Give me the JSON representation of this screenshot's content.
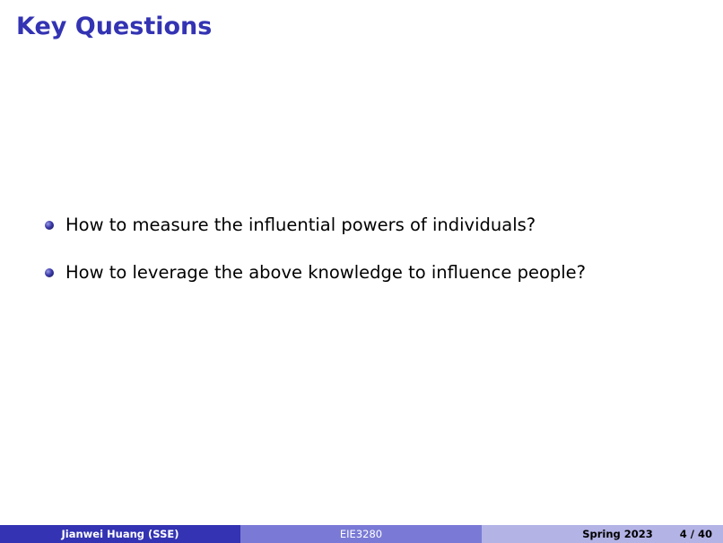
{
  "slide": {
    "title": "Key Questions",
    "bullets": [
      "How to measure the influential powers of individuals?",
      "How to leverage the above knowledge to influence people?"
    ]
  },
  "footer": {
    "author": "Jianwei Huang  (SSE)",
    "course": "EIE3280",
    "date": "Spring 2023",
    "page": "4 / 40"
  },
  "colors": {
    "title": "#3333b3",
    "footer_left": "#3333b3",
    "footer_center": "#7a7ad6",
    "footer_right": "#b3b3e6"
  }
}
